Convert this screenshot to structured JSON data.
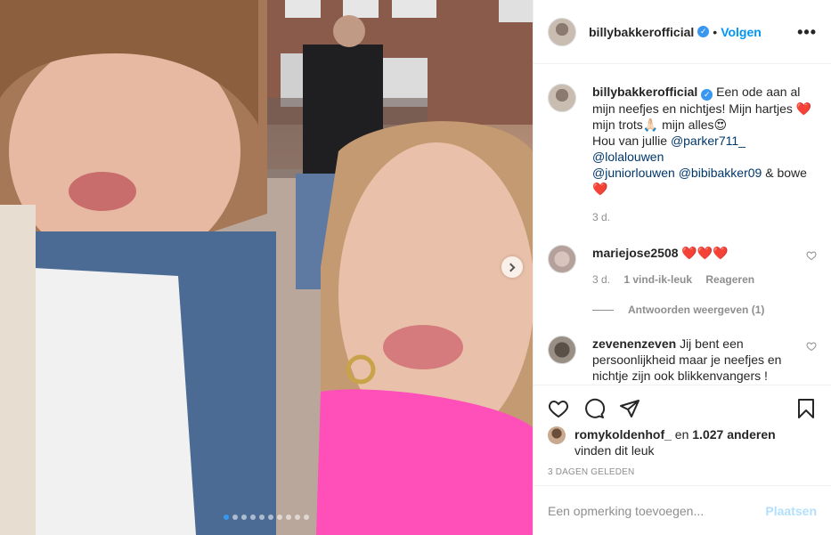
{
  "header": {
    "username": "billybakkerofficial",
    "follow_label": "Volgen",
    "bullet": "•",
    "more_label": "•••"
  },
  "caption": {
    "username": "billybakkerofficial",
    "text_1": "Een ode aan al mijn neefjes en nichtjes! Mijn hartjes ",
    "heart_1": "❤️",
    "text_2": "mijn trots",
    "pray": "🙏🏻",
    "text_3": " mijn alles",
    "heart_eyes": "😍",
    "text_4": "Hou van jullie ",
    "mentions": [
      "@parker711_",
      "@lolalouwen",
      "@juniorlouwen",
      "@bibibakker09"
    ],
    "text_5": " & bowe ",
    "heart_2": "❤️",
    "time": "3 d."
  },
  "comments": [
    {
      "username": "mariejose2508",
      "text": "❤️❤️❤️",
      "time": "3 d.",
      "likes": "1 vind-ik-leuk",
      "reply_label": "Reageren",
      "view_replies": "Antwoorden weergeven (1)"
    },
    {
      "username": "zevenenzeven",
      "text": "Jij bent een persoonlijkheid maar je neefjes en nichtje zijn ook blikkenvangers !"
    }
  ],
  "likes": {
    "user": "romykoldenhof_",
    "connector": "en",
    "others": "1.027 anderen",
    "suffix": "vinden dit leuk"
  },
  "date": "3 DAGEN GELEDEN",
  "add_comment": {
    "placeholder": "Een opmerking toevoegen...",
    "post_label": "Plaatsen"
  },
  "carousel": {
    "count": 10,
    "active_index": 0
  },
  "colors": {
    "accent": "#0095f6",
    "verified": "#3897f0",
    "mention": "#00376b",
    "muted": "#8e8e8e"
  },
  "icons": [
    "heart-icon",
    "comment-icon",
    "share-icon",
    "save-icon",
    "verified-icon",
    "more-icon",
    "chevron-right-icon"
  ]
}
